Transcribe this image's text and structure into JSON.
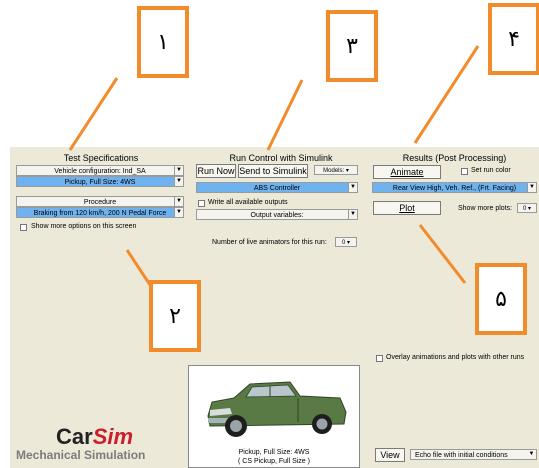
{
  "callouts": {
    "c1": "۱",
    "c2": "۲",
    "c3": "۳",
    "c4": "۴",
    "c5": "۵"
  },
  "test_specs": {
    "title": "Test Specifications",
    "vehicle_config": "Vehicle configuration: Ind_SA",
    "vehicle": "Pickup, Full Size: 4WS",
    "procedure_label": "Procedure",
    "procedure": "Braking from 120 km/h, 200 N Pedal Force",
    "show_more": "Show more options on this screen"
  },
  "run_control": {
    "title": "Run Control with Simulink",
    "run_now": "Run Now",
    "send": "Send to Simulink",
    "models": "Models:",
    "controller": "ABS Controller",
    "write_all": "Write all available outputs",
    "output_vars": "Output variables:",
    "live_animators": "Number of live animators for this run:",
    "live_animators_value": "0"
  },
  "results": {
    "title": "Results (Post Processing)",
    "animate": "Animate",
    "set_run_color": "Set run color",
    "view": "Rear View High, Veh. Ref., (Frt. Facing)",
    "plot": "Plot",
    "show_more_plots": "Show more plots:",
    "show_more_plots_value": "0",
    "overlay": "Overlay animations and plots with other runs",
    "view_btn": "View",
    "echo": "Echo file with initial conditions"
  },
  "vehicle_preview": {
    "caption1": "Pickup, Full Size: 4WS",
    "caption2": "( CS Pickup, Full Size )"
  },
  "logo": {
    "car": "Car",
    "sim": "Sim",
    "subtitle": "Mechanical Simulation"
  },
  "colors": {
    "callout_border": "#f28b2a",
    "leader_line": "#f28b2a",
    "selected_blue": "#6fb2f0",
    "logo_red": "#cc1e2a",
    "panel_bg": "#ece9d8"
  }
}
